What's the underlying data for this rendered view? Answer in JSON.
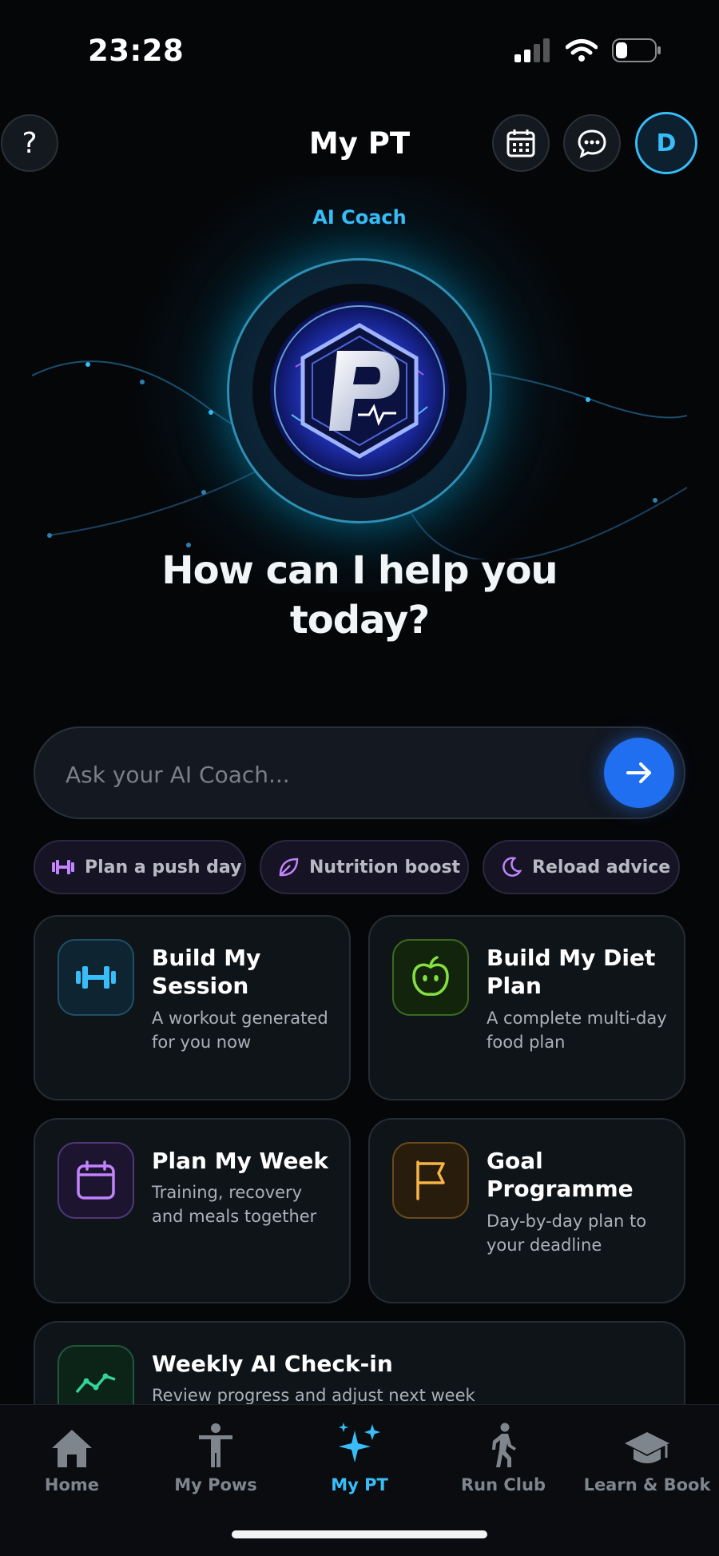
{
  "status": {
    "time": "23:28"
  },
  "header": {
    "title": "My PT",
    "avatar_initial": "D",
    "help_symbol": "?"
  },
  "hero": {
    "label": "AI Coach",
    "headline_line1": "How can I help you",
    "headline_line2": "today?"
  },
  "ask": {
    "placeholder": "Ask your AI Coach..."
  },
  "chips": [
    {
      "label": "Plan a push day",
      "icon": "dumbbell-icon",
      "color": "#c084fc"
    },
    {
      "label": "Nutrition boost",
      "icon": "leaf-icon",
      "color": "#c084fc"
    },
    {
      "label": "Reload advice",
      "icon": "moon-icon",
      "color": "#c084fc"
    }
  ],
  "cards": [
    {
      "title": "Build My Session",
      "desc": "A workout generated for you now",
      "icon": "dumbbell-icon",
      "color": "#38bdf8"
    },
    {
      "title": "Build My Diet Plan",
      "desc": "A complete multi-day food plan",
      "icon": "apple-icon",
      "color": "#84e040"
    },
    {
      "title": "Plan My Week",
      "desc": "Training, recovery and meals together",
      "icon": "calendar-icon",
      "color": "#c084fc"
    },
    {
      "title": "Goal Programme",
      "desc": "Day-by-day plan to your deadline",
      "icon": "flag-icon",
      "color": "#f5b544"
    },
    {
      "title": "Weekly AI Check-in",
      "desc": "Review progress and adjust next week",
      "icon": "trend-icon",
      "color": "#34d399"
    }
  ],
  "nav": [
    {
      "label": "Home",
      "icon": "home-icon"
    },
    {
      "label": "My Pows",
      "icon": "person-icon"
    },
    {
      "label": "My PT",
      "icon": "sparkles-icon",
      "active": true
    },
    {
      "label": "Run Club",
      "icon": "walker-icon"
    },
    {
      "label": "Learn & Book",
      "icon": "graduation-cap-icon"
    }
  ],
  "colors": {
    "accent": "#38bdf8",
    "send": "#1f6ff0",
    "background": "#050608"
  }
}
